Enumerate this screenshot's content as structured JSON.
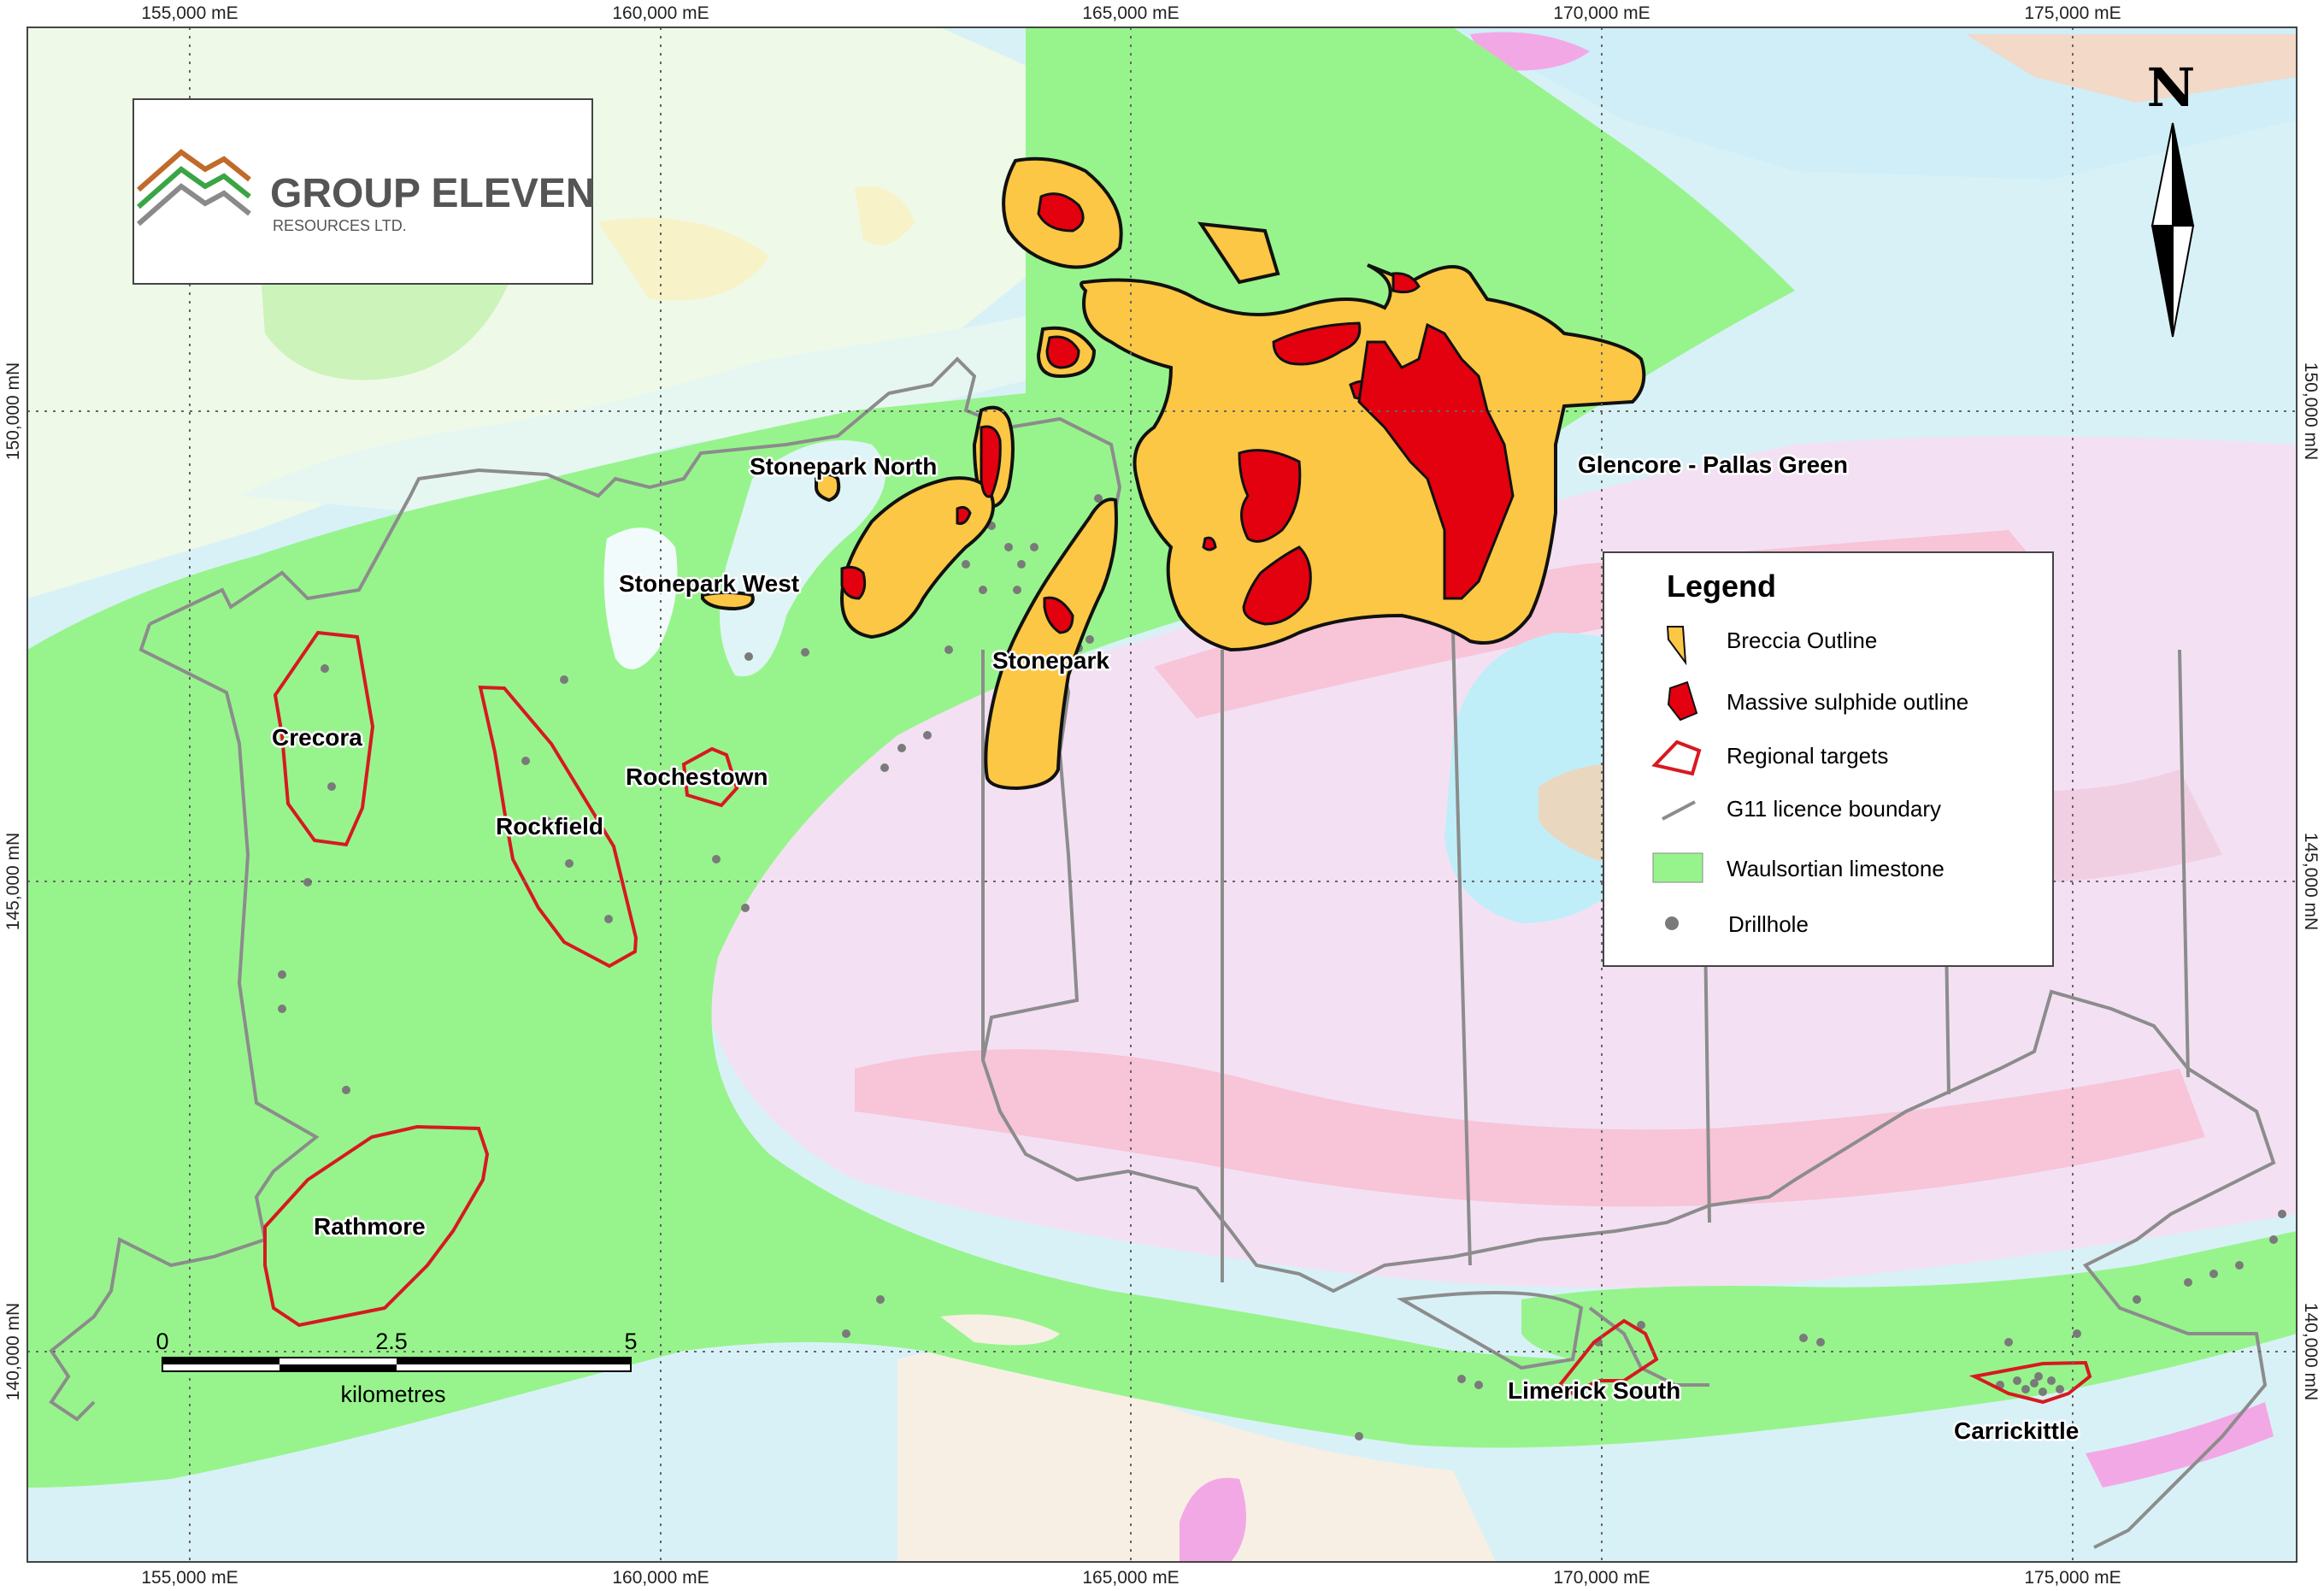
{
  "logo": {
    "title": "GROUP ELEVEN",
    "subtitle": "RESOURCES LTD.",
    "colors": [
      "#c26a2a",
      "#3aa544",
      "#8a8a8a"
    ]
  },
  "north_arrow": {
    "label": "N"
  },
  "coordinates": {
    "eastings": [
      "155,000 mE",
      "160,000 mE",
      "165,000 mE",
      "170,000 mE",
      "175,000 mE"
    ],
    "northings": [
      "150,000 mN",
      "145,000 mN",
      "140,000 mN"
    ]
  },
  "targets": {
    "stonepark_north": "Stonepark North",
    "stonepark_west": "Stonepark West",
    "stonepark": "Stonepark",
    "glencore": "Glencore - Pallas Green",
    "crecora": "Crecora",
    "rockfield": "Rockfield",
    "rochestown": "Rochestown",
    "rathmore": "Rathmore",
    "limerick_south": "Limerick South",
    "carrickittle": "Carrickittle"
  },
  "legend": {
    "title": "Legend",
    "items": [
      {
        "label": "Breccia Outline",
        "icon": "breccia-swatch",
        "color": "#fcc744"
      },
      {
        "label": "Massive sulphide outline",
        "icon": "sulphide-swatch",
        "color": "#e3000f"
      },
      {
        "label": "Regional targets",
        "icon": "target-outline",
        "color": "#d71920"
      },
      {
        "label": "G11 licence boundary",
        "icon": "boundary-line",
        "color": "#8c8c8c"
      },
      {
        "label": "Waulsortian limestone",
        "icon": "limestone-swatch",
        "color": "#97f48c"
      },
      {
        "label": "Drillhole",
        "icon": "drillhole-dot",
        "color": "#7a7a7a"
      }
    ]
  },
  "scale_bar": {
    "ticks": [
      "0",
      "2.5",
      "5"
    ],
    "unit": "kilometres"
  },
  "colors": {
    "limestone": "#97f48c",
    "breccia": "#fcc744",
    "sulphide": "#e3000f",
    "targets": "#d71920",
    "boundary": "#8c8c8c",
    "water": "#cdeef6"
  }
}
